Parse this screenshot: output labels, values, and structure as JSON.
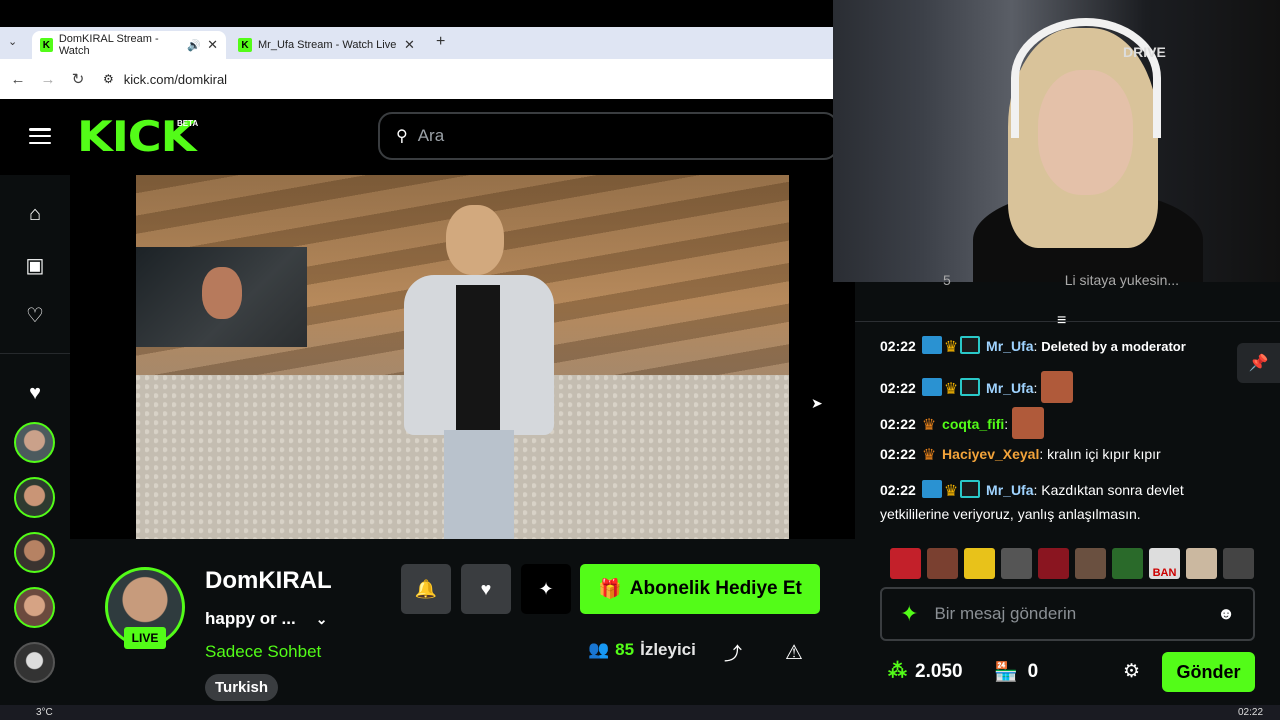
{
  "browser": {
    "tabs": [
      {
        "label": "DomKIRAL Stream - Watch"
      },
      {
        "label": "Mr_Ufa Stream - Watch Live on"
      }
    ],
    "url": "kick.com/domkiral",
    "favicon_letter": "K"
  },
  "header": {
    "logo": "KICK",
    "beta": "BETA",
    "search_placeholder": "Ara"
  },
  "channel": {
    "name": "DomKIRAL",
    "title": "happy or ...",
    "category": "Sadece Sohbet",
    "tag": "Turkish",
    "live_label": "LIVE",
    "viewers_count": "85",
    "viewers_label": "İzleyici",
    "subscribe_gift_label": "Abonelik Hediye Et"
  },
  "webcam": {
    "chair_text": "DRIVE"
  },
  "chat": {
    "partial_top": {
      "count": "5",
      "text": "Li sitaya yukesin..."
    },
    "messages": [
      {
        "time": "02:22",
        "user": "Mr_Ufa",
        "text": "Deleted by a moderator",
        "color": "blue"
      },
      {
        "time": "02:22",
        "user": "Mr_Ufa",
        "text": "",
        "color": "blue"
      },
      {
        "time": "02:22",
        "user": "coqta_fifi",
        "text": "",
        "color": "green"
      },
      {
        "time": "02:22",
        "user": "Haciyev_Xeyal",
        "text": "kralın içi kıpır kıpır",
        "color": "orange"
      },
      {
        "time": "02:22",
        "user": "Mr_Ufa",
        "text": "Kazdıktan sonra devlet yetkililerine veriyoruz, yanlış anlaşılmasın.",
        "color": "blue"
      }
    ],
    "input_placeholder": "Bir mesaj gönderin",
    "points": "2.050",
    "store_count": "0",
    "send_label": "Gönder",
    "ban_emote_text": "BAN"
  },
  "taskbar": {
    "temperature": "3°C",
    "clock": "02:22"
  },
  "colors": {
    "accent": "#53fc18",
    "background": "#0b0e0f"
  }
}
